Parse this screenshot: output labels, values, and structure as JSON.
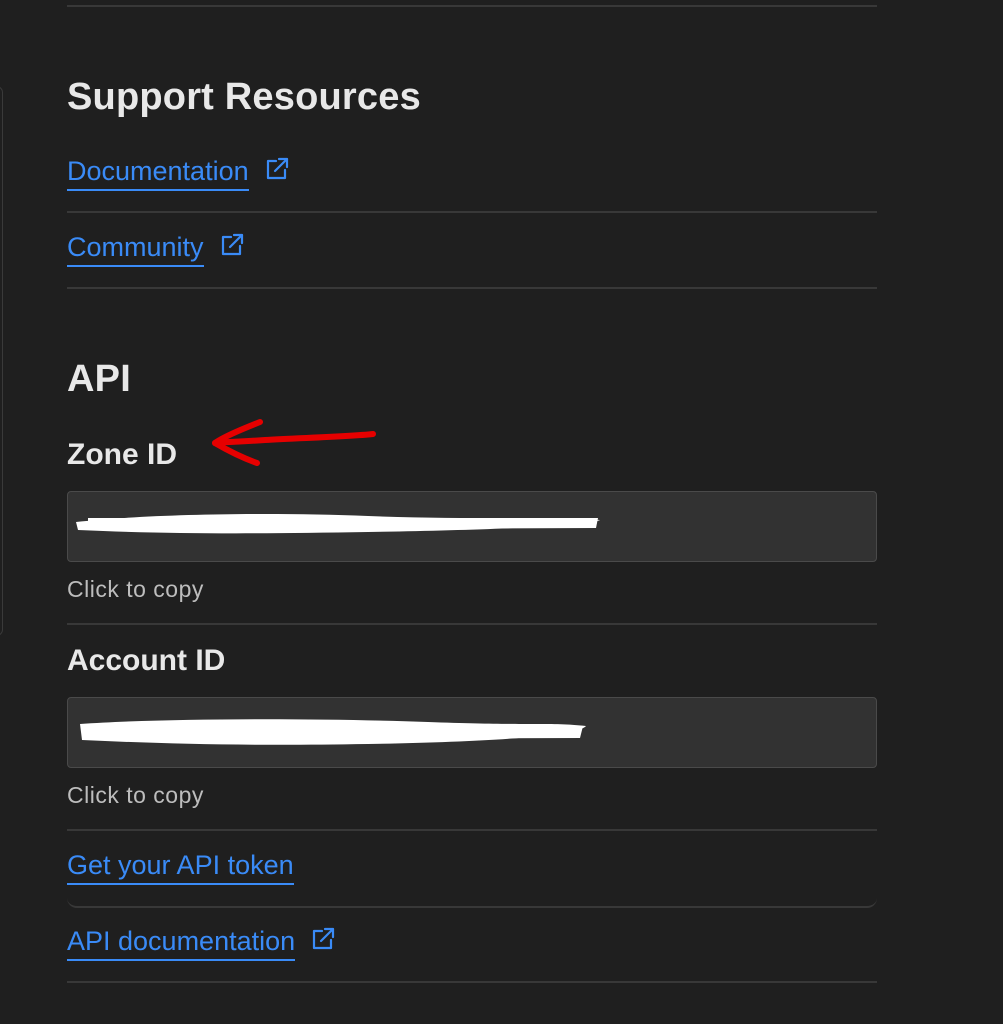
{
  "support": {
    "heading": "Support Resources",
    "links": [
      {
        "label": "Documentation",
        "icon": "external-link-icon"
      },
      {
        "label": "Community",
        "icon": "external-link-icon"
      }
    ]
  },
  "api": {
    "heading": "API",
    "zone": {
      "label": "Zone ID",
      "value_redacted": true,
      "hint": "Click to copy"
    },
    "account": {
      "label": "Account ID",
      "value_redacted": true,
      "hint": "Click to copy"
    },
    "token_link": "Get your API token",
    "docs_link": {
      "label": "API documentation",
      "icon": "external-link-icon"
    }
  },
  "colors": {
    "background": "#1f1f1f",
    "link": "#3a8bf7",
    "annotation_arrow": "#e60000"
  }
}
